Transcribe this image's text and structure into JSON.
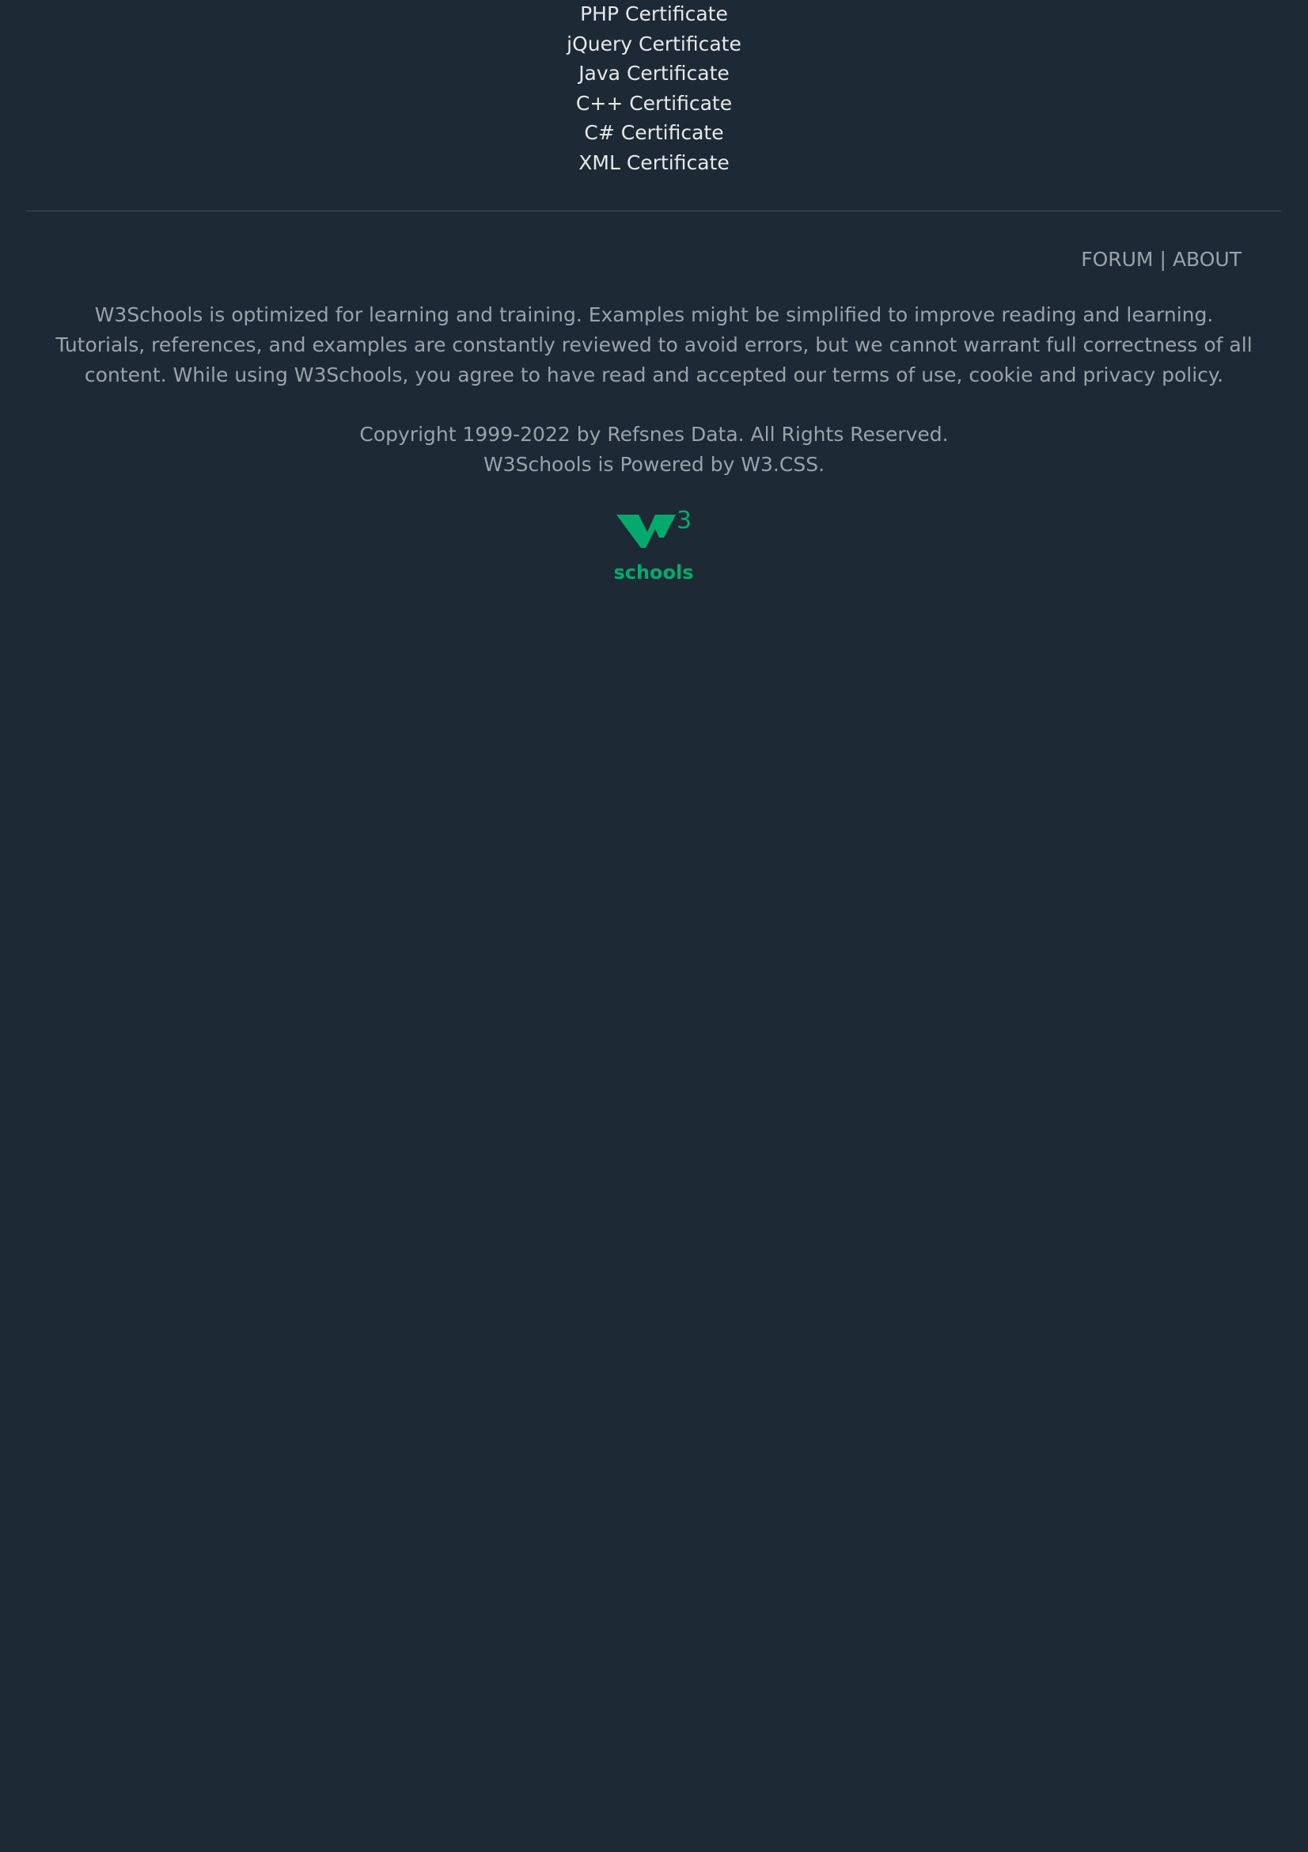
{
  "certificates": [
    {
      "label": "PHP Certificate"
    },
    {
      "label": "jQuery Certificate"
    },
    {
      "label": "Java Certificate"
    },
    {
      "label": "C++ Certificate"
    },
    {
      "label": "C# Certificate"
    },
    {
      "label": "XML Certificate"
    }
  ],
  "footer": {
    "forum_label": "FORUM",
    "separator": "|",
    "about_label": "ABOUT",
    "disclaimer": "W3Schools is optimized for learning and training. Examples might be simplified to improve reading and learning. Tutorials, references, and examples are constantly reviewed to avoid errors, but we cannot warrant full correctness of all content. While using W3Schools, you agree to have read and accepted our terms of use, cookie and privacy policy.",
    "copyright_line": "Copyright 1999-2022 by Refsnes Data. All Rights Reserved.",
    "powered_line": "W3Schools is Powered by W3.CSS."
  },
  "logo": {
    "icon": "w3schools-logo",
    "superscript": "3",
    "wordmark": "schools",
    "color": "#04aa6d"
  },
  "colors": {
    "background": "#1d2a35",
    "link_text": "#e6e8ea",
    "muted_text": "#9aa3a9",
    "divider": "#3f4c56",
    "brand_green": "#04aa6d"
  }
}
